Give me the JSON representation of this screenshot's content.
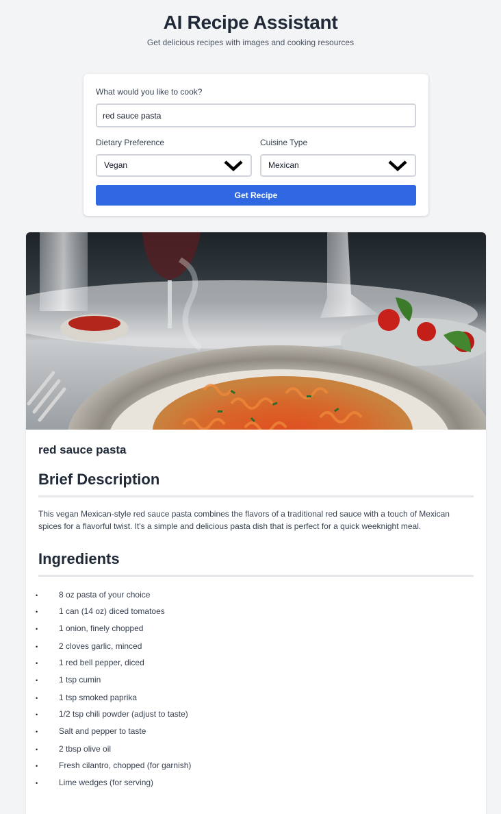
{
  "header": {
    "title": "AI Recipe Assistant",
    "subtitle": "Get delicious recipes with images and cooking resources"
  },
  "form": {
    "query_label": "What would you like to cook?",
    "query_value": "red sauce pasta",
    "diet_label": "Dietary Preference",
    "diet_value": "Vegan",
    "cuisine_label": "Cuisine Type",
    "cuisine_value": "Mexican",
    "submit_label": "Get Recipe"
  },
  "recipe": {
    "name": "red sauce pasta",
    "description_heading": "Brief Description",
    "description": "This vegan Mexican-style red sauce pasta combines the flavors of a traditional red sauce with a touch of Mexican spices for a flavorful twist. It's a simple and delicious pasta dish that is perfect for a quick weeknight meal.",
    "ingredients_heading": "Ingredients",
    "ingredients": [
      "8 oz pasta of your choice",
      "1 can (14 oz) diced tomatoes",
      "1 onion, finely chopped",
      "2 cloves garlic, minced",
      "1 red bell pepper, diced",
      "1 tsp cumin",
      "1 tsp smoked paprika",
      "1/2 tsp chili powder (adjust to taste)",
      "Salt and pepper to taste",
      "2 tbsp olive oil",
      "Fresh cilantro, chopped (for garnish)",
      "Lime wedges (for serving)"
    ]
  },
  "icons": {
    "dropdown": "chevron-down-icon",
    "bullet": "bullet-icon"
  },
  "colors": {
    "accent": "#3067e3",
    "background": "#f3f4f6",
    "card": "#ffffff",
    "text": "#1f2937"
  }
}
